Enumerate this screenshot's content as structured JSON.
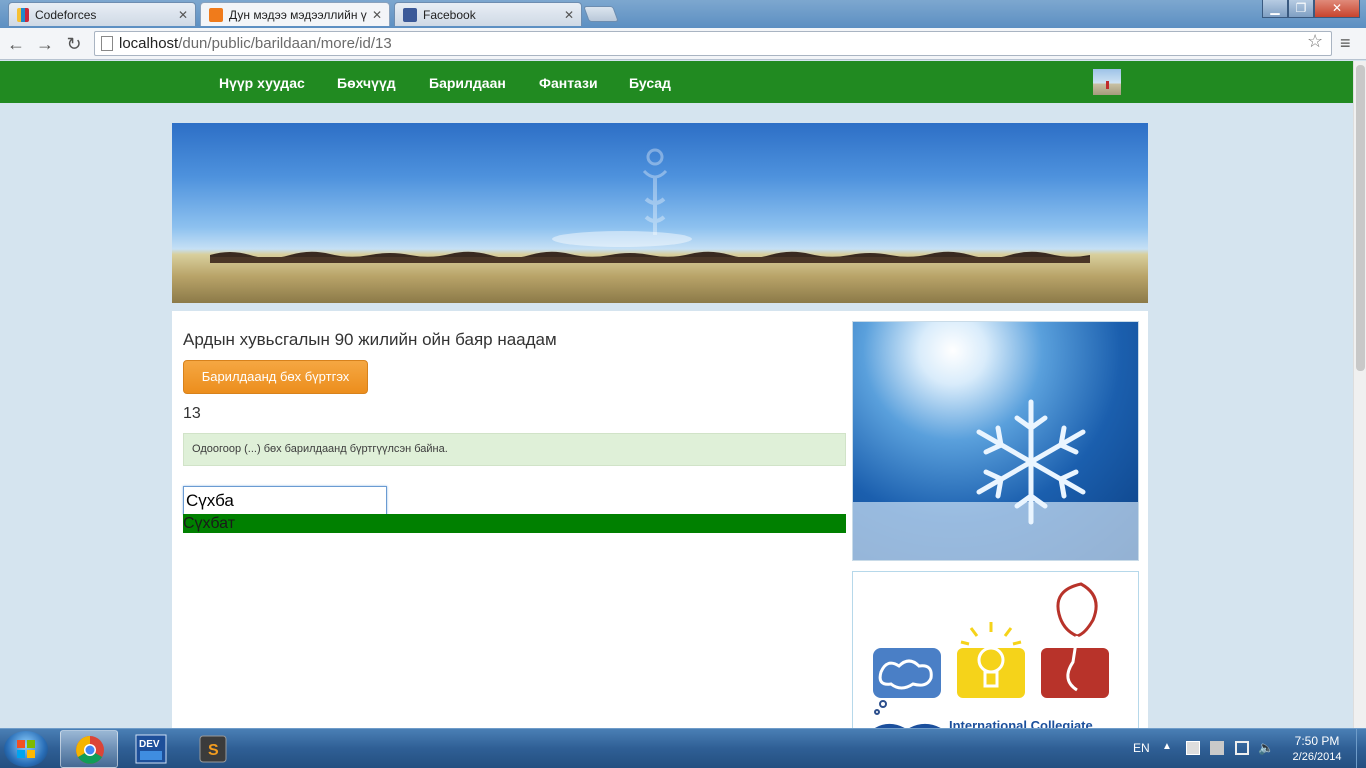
{
  "browser": {
    "tabs": [
      {
        "title": "Codeforces",
        "icon": "codeforces-icon"
      },
      {
        "title": "Дун мэдээ мэдээллийн ү",
        "icon": "xampp-icon"
      },
      {
        "title": "Facebook",
        "icon": "facebook-icon"
      }
    ],
    "url_host": "localhost",
    "url_path": "/dun/public/barildaan/more/id/13"
  },
  "nav": {
    "items": [
      "Нүүр хуудас",
      "Бөхчүүд",
      "Барилдаан",
      "Фантази",
      "Бусад"
    ]
  },
  "main": {
    "event_title": "Ардын хувьсгалын 90 жилийн ойн баяр наадам",
    "register_button": "Барилдаанд бөх бүртгэх",
    "event_id": "13",
    "alert_text": "Одоогоор (...) бөх барилдаанд бүртгүүлсэн байна.",
    "search_value": "Сүхба",
    "suggestion": "Сүхбат"
  },
  "sidebar": {
    "acm_text": "International Collegiate"
  },
  "taskbar": {
    "lang": "EN",
    "time": "7:50 PM",
    "date": "2/26/2014"
  },
  "colors": {
    "navbar": "#218a21",
    "button": "#ec8e1d",
    "alert_bg": "#dff0d8",
    "suggestion_bg": "#008000"
  }
}
